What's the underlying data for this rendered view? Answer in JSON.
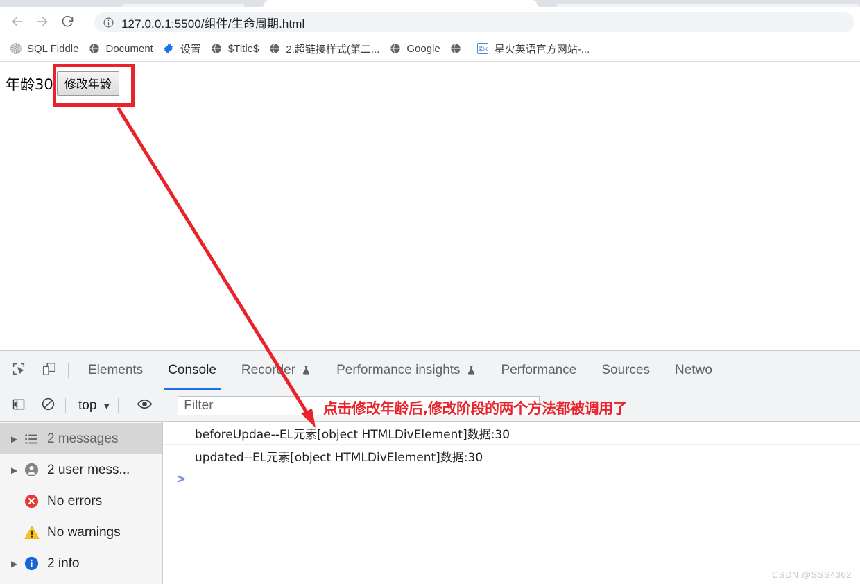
{
  "browser": {
    "nav": {
      "back_icon": "arrow-left-icon",
      "forward_icon": "arrow-right-icon",
      "reload_icon": "reload-icon"
    },
    "omnibox": {
      "info_icon": "site-info-icon",
      "url": "127.0.0.1:5500/组件/生命周期.html"
    },
    "bookmarks": [
      {
        "label": "SQL Fiddle",
        "icon": "sql-fiddle-favicon"
      },
      {
        "label": "Document",
        "icon": "globe-favicon"
      },
      {
        "label": "设置",
        "icon": "gear-favicon"
      },
      {
        "label": "$Title$",
        "icon": "globe-favicon"
      },
      {
        "label": "2.超链接样式(第二...",
        "icon": "globe-favicon"
      },
      {
        "label": "Google",
        "icon": "globe-favicon"
      },
      {
        "label": "",
        "icon": "globe-favicon"
      },
      {
        "label": "星火英语官方网站-...",
        "icon": "xinghuo-favicon"
      }
    ]
  },
  "page": {
    "age_text": "年龄30",
    "button_label": "修改年龄"
  },
  "annotation": {
    "note": "点击修改年龄后,修改阶段的两个方法都被调用了",
    "color": "#e8232a"
  },
  "devtools": {
    "left_icons": [
      {
        "name": "inspect-element-icon"
      },
      {
        "name": "device-toolbar-icon"
      }
    ],
    "tabs": [
      {
        "label": "Elements",
        "active": false,
        "badge": ""
      },
      {
        "label": "Console",
        "active": true,
        "badge": ""
      },
      {
        "label": "Recorder",
        "active": false,
        "badge": "flask-icon"
      },
      {
        "label": "Performance insights",
        "active": false,
        "badge": "flask-icon"
      },
      {
        "label": "Performance",
        "active": false,
        "badge": ""
      },
      {
        "label": "Sources",
        "active": false,
        "badge": ""
      },
      {
        "label": "Netwo",
        "active": false,
        "badge": ""
      }
    ],
    "toolbar": {
      "sidebar_toggle_icon": "console-sidebar-toggle-icon",
      "clear_icon": "clear-console-icon",
      "context": "top",
      "caret": "▼",
      "eye_icon": "live-expression-icon",
      "filter_placeholder": "Filter"
    },
    "sidebar": [
      {
        "label": "2 messages",
        "icon": "list-icon",
        "expandable": true,
        "selected": true
      },
      {
        "label": "2 user mess...",
        "icon": "user-icon",
        "expandable": true,
        "selected": false
      },
      {
        "label": "No errors",
        "icon": "error-icon",
        "expandable": false,
        "selected": false
      },
      {
        "label": "No warnings",
        "icon": "warning-icon",
        "expandable": false,
        "selected": false
      },
      {
        "label": "2 info",
        "icon": "info-icon",
        "expandable": true,
        "selected": false
      }
    ],
    "logs": [
      "beforeUpdae--EL元素[object HTMLDivElement]数据:30",
      "updated--EL元素[object HTMLDivElement]数据:30"
    ],
    "prompt": ">"
  },
  "watermark": "CSDN @SSS4362"
}
